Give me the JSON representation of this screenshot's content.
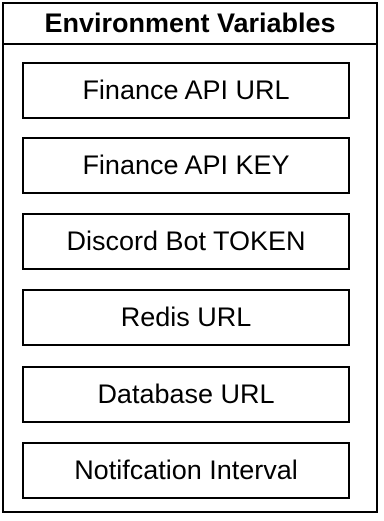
{
  "group": {
    "title": "Environment Variables",
    "items": [
      "Finance API URL",
      "Finance API KEY",
      "Discord Bot TOKEN",
      "Redis URL",
      "Database URL",
      "Notifcation Interval"
    ]
  },
  "colors": {
    "border": "#000000",
    "background": "#ffffff",
    "text": "#000000"
  }
}
